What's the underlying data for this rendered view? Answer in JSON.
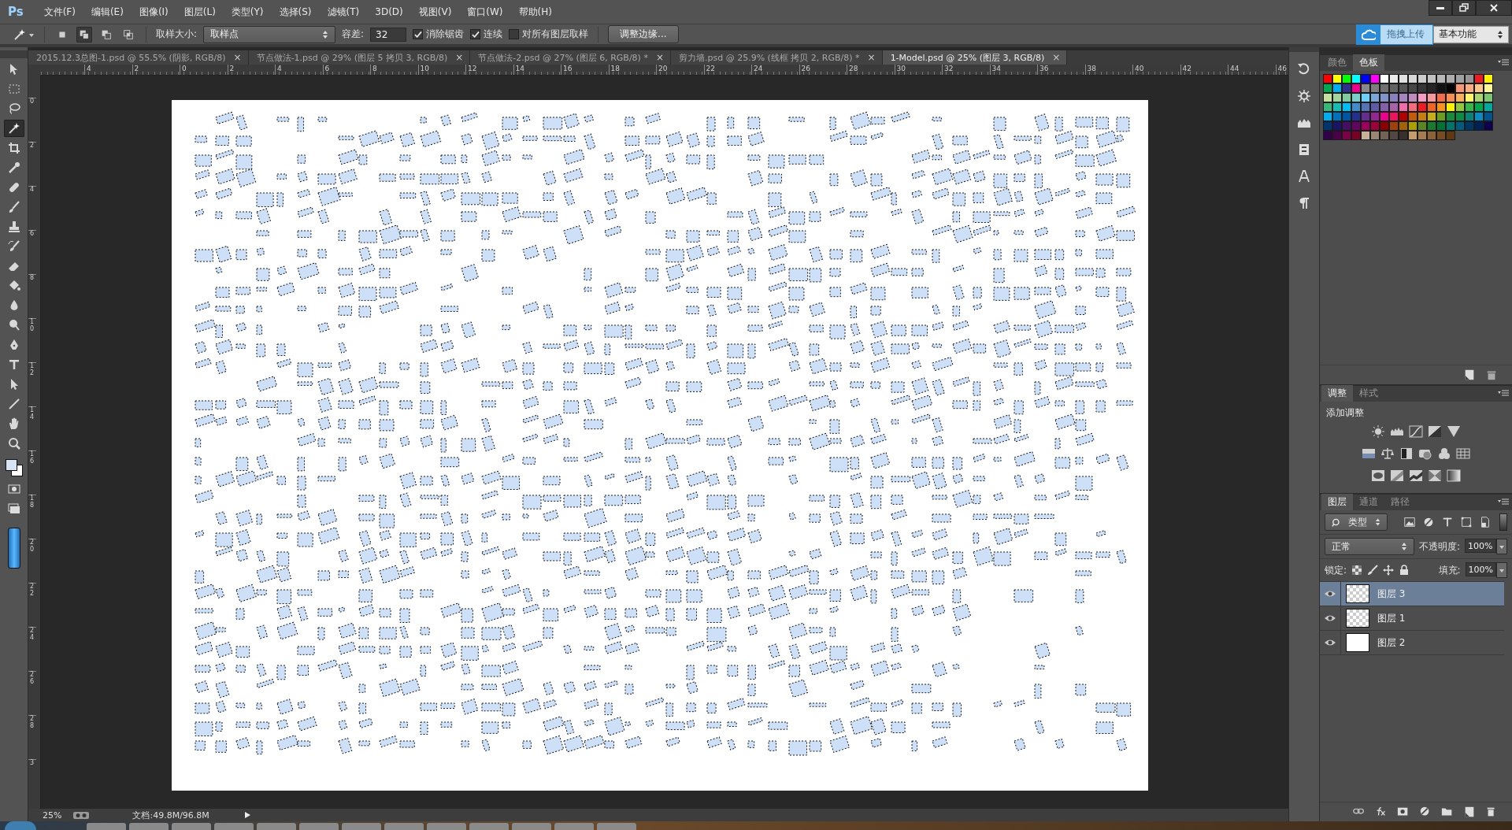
{
  "app": {
    "logo": "Ps"
  },
  "menu": [
    "文件(F)",
    "编辑(E)",
    "图像(I)",
    "图层(L)",
    "类型(Y)",
    "选择(S)",
    "滤镜(T)",
    "3D(D)",
    "视图(V)",
    "窗口(W)",
    "帮助(H)"
  ],
  "options_bar": {
    "mode_buttons": [
      {
        "kind": "new",
        "selected": false
      },
      {
        "kind": "add",
        "selected": true
      },
      {
        "kind": "subtract",
        "selected": false
      },
      {
        "kind": "intersect",
        "selected": false
      }
    ],
    "sample_size_label": "取样大小:",
    "sample_size": "取样点",
    "tolerance_label": "容差:",
    "tolerance": "32",
    "checkboxes": [
      {
        "label": "消除锯齿",
        "checked": true
      },
      {
        "label": "连续",
        "checked": true
      },
      {
        "label": "对所有图层取样",
        "checked": false
      }
    ],
    "refine_edge": "调整边缘..."
  },
  "upload_button": "拖拽上传",
  "workspace": "基本功能",
  "tabs": [
    {
      "label": "2015.12.3总图-1.psd @ 55.5% (阴影, RGB/8)",
      "close": "×",
      "selected": false
    },
    {
      "label": "节点做法-1.psd @ 29% (图层 5 拷贝 3, RGB/8)",
      "close": "×",
      "selected": false
    },
    {
      "label": "节点做法-2.psd @ 27% (图层 6, RGB/8) *",
      "close": "×",
      "selected": false
    },
    {
      "label": "剪力墙.psd @ 25.9% (线框 拷贝 2, RGB/8) *",
      "close": "×",
      "selected": false
    },
    {
      "label": "1-Model.psd @ 25% (图层 3, RGB/8)",
      "close": "×",
      "selected": true
    }
  ],
  "rulers": {
    "horizontal": [
      "4",
      "2",
      "0",
      "2",
      "4",
      "6",
      "8",
      "10",
      "12",
      "14",
      "16",
      "18",
      "20",
      "22",
      "24",
      "26",
      "28",
      "30",
      "32",
      "34",
      "36",
      "38",
      "40",
      "42",
      "44",
      "46"
    ],
    "vertical": [
      "0",
      "2",
      "4",
      "6",
      "8",
      "10",
      "12",
      "14",
      "16",
      "18",
      "20",
      "22",
      "24",
      "26",
      "28",
      "3"
    ]
  },
  "tools": [
    {
      "kind": "move",
      "selected": false
    },
    {
      "kind": "marquee",
      "selected": false
    },
    {
      "kind": "lasso",
      "selected": false
    },
    {
      "kind": "magic_wand",
      "selected": true
    },
    {
      "kind": "crop",
      "selected": false
    },
    {
      "kind": "eyedropper",
      "selected": false
    },
    {
      "kind": "healing",
      "selected": false
    },
    {
      "kind": "brush",
      "selected": false
    },
    {
      "kind": "stamp",
      "selected": false
    },
    {
      "kind": "history_brush",
      "selected": false
    },
    {
      "kind": "eraser",
      "selected": false
    },
    {
      "kind": "bucket",
      "selected": false
    },
    {
      "kind": "blur",
      "selected": false
    },
    {
      "kind": "dodge",
      "selected": false
    },
    {
      "kind": "pen",
      "selected": false
    },
    {
      "kind": "type",
      "selected": false
    },
    {
      "kind": "path_select",
      "selected": false
    },
    {
      "kind": "line",
      "selected": false
    },
    {
      "kind": "hand",
      "selected": false
    },
    {
      "kind": "zoom",
      "selected": false
    }
  ],
  "status_bar": {
    "zoom": "25%",
    "document": "文档:49.8M/96.8M"
  },
  "swatches_panel": {
    "tabs": [
      {
        "label": "颜色",
        "selected": false
      },
      {
        "label": "色板",
        "selected": true
      }
    ],
    "swatches": [
      {
        "color": "#ff0000"
      },
      {
        "color": "#ffff00"
      },
      {
        "color": "#00ff00"
      },
      {
        "color": "#00ffff"
      },
      {
        "color": "#0000ff"
      },
      {
        "color": "#ff00ff"
      },
      {
        "color": "#ffffff"
      },
      {
        "color": "#ebebeb"
      },
      {
        "color": "#e1e1e1"
      },
      {
        "color": "#d7d7d7"
      },
      {
        "color": "#cccccc"
      },
      {
        "color": "#c2c2c2"
      },
      {
        "color": "#b7b7b7"
      },
      {
        "color": "#acacac"
      },
      {
        "color": "#a0a0a0"
      },
      {
        "color": "#959595"
      },
      {
        "color": "#ee1d24"
      },
      {
        "color": "#fff100"
      },
      {
        "color": "#00a650"
      },
      {
        "color": "#00aeef"
      },
      {
        "color": "#2e3192"
      },
      {
        "color": "#ed008c"
      },
      {
        "color": "#898989"
      },
      {
        "color": "#7d7d7d"
      },
      {
        "color": "#707070"
      },
      {
        "color": "#626262"
      },
      {
        "color": "#555555"
      },
      {
        "color": "#464646"
      },
      {
        "color": "#363636"
      },
      {
        "color": "#262626"
      },
      {
        "color": "#111111"
      },
      {
        "color": "#000000"
      },
      {
        "color": "#f7977a"
      },
      {
        "color": "#fbad82"
      },
      {
        "color": "#fdc68c"
      },
      {
        "color": "#fff799"
      },
      {
        "color": "#c6df9c"
      },
      {
        "color": "#a4d49d"
      },
      {
        "color": "#81ca9d"
      },
      {
        "color": "#7bcdc9"
      },
      {
        "color": "#6ccff7"
      },
      {
        "color": "#7ca6d8"
      },
      {
        "color": "#8293ca"
      },
      {
        "color": "#8881be"
      },
      {
        "color": "#a286bd"
      },
      {
        "color": "#bc8cbf"
      },
      {
        "color": "#f49bc1"
      },
      {
        "color": "#f5999d"
      },
      {
        "color": "#f16c4d"
      },
      {
        "color": "#f68e54"
      },
      {
        "color": "#fbaf5a"
      },
      {
        "color": "#fff467"
      },
      {
        "color": "#acd372"
      },
      {
        "color": "#7dc473"
      },
      {
        "color": "#39b778"
      },
      {
        "color": "#17bcb4"
      },
      {
        "color": "#00bef3"
      },
      {
        "color": "#438ccb"
      },
      {
        "color": "#5573b7"
      },
      {
        "color": "#5e5ca7"
      },
      {
        "color": "#855fa8"
      },
      {
        "color": "#a763a9"
      },
      {
        "color": "#ef6ea8"
      },
      {
        "color": "#f16d7e"
      },
      {
        "color": "#ee1d24"
      },
      {
        "color": "#f16522"
      },
      {
        "color": "#f7941d"
      },
      {
        "color": "#fff100"
      },
      {
        "color": "#8fc63d"
      },
      {
        "color": "#37b44a"
      },
      {
        "color": "#00a650"
      },
      {
        "color": "#00a99e"
      },
      {
        "color": "#00aeef"
      },
      {
        "color": "#0072bc"
      },
      {
        "color": "#0054a5"
      },
      {
        "color": "#262f8f"
      },
      {
        "color": "#662d91"
      },
      {
        "color": "#91278f"
      },
      {
        "color": "#ec008c"
      },
      {
        "color": "#ed145b"
      },
      {
        "color": "#b30000"
      },
      {
        "color": "#c35b0a"
      },
      {
        "color": "#c47e11"
      },
      {
        "color": "#c4b016"
      },
      {
        "color": "#6b9e1f"
      },
      {
        "color": "#198a3d"
      },
      {
        "color": "#0c8b44"
      },
      {
        "color": "#0a8277"
      },
      {
        "color": "#0b8bbf"
      },
      {
        "color": "#00558f"
      },
      {
        "color": "#003471"
      },
      {
        "color": "#1b1464"
      },
      {
        "color": "#440e62"
      },
      {
        "color": "#630460"
      },
      {
        "color": "#9e005d"
      },
      {
        "color": "#9e0039"
      },
      {
        "color": "#8c0000"
      },
      {
        "color": "#a0410d"
      },
      {
        "color": "#a36209"
      },
      {
        "color": "#aba000"
      },
      {
        "color": "#598527"
      },
      {
        "color": "#1a7b30"
      },
      {
        "color": "#007236"
      },
      {
        "color": "#00736a"
      },
      {
        "color": "#005b7f"
      },
      {
        "color": "#003663"
      },
      {
        "color": "#002157"
      },
      {
        "color": "#0d004c"
      },
      {
        "color": "#32004b"
      },
      {
        "color": "#4b0049"
      },
      {
        "color": "#7b0046"
      },
      {
        "color": "#7a0026"
      },
      {
        "color": "#c7b299"
      },
      {
        "color": "#998675"
      },
      {
        "color": "#736357"
      },
      {
        "color": "#534741"
      },
      {
        "color": "#37302a"
      },
      {
        "color": "#c69c6d"
      },
      {
        "color": "#a67c52"
      },
      {
        "color": "#8c6239"
      },
      {
        "color": "#754c24"
      },
      {
        "color": "#603913"
      }
    ]
  },
  "adjustments_panel": {
    "tabs": [
      {
        "label": "调整",
        "selected": true
      },
      {
        "label": "样式",
        "selected": false
      }
    ],
    "heading": "添加调整"
  },
  "layers_panel": {
    "tabs": [
      {
        "label": "图层",
        "selected": true
      },
      {
        "label": "通道",
        "selected": false
      },
      {
        "label": "路径",
        "selected": false
      }
    ],
    "filter": "类型",
    "blend_mode": "正常",
    "opacity_label": "不透明度:",
    "opacity": "100%",
    "lock_label": "锁定:",
    "fill_label": "填充:",
    "fill": "100%",
    "layers": [
      {
        "name": "图层 3",
        "selected": true,
        "visible": true,
        "kind": "transparent"
      },
      {
        "name": "图层 1",
        "selected": false,
        "visible": true,
        "kind": "transparent"
      },
      {
        "name": "图层 2",
        "selected": false,
        "visible": true,
        "kind": "white"
      }
    ]
  }
}
